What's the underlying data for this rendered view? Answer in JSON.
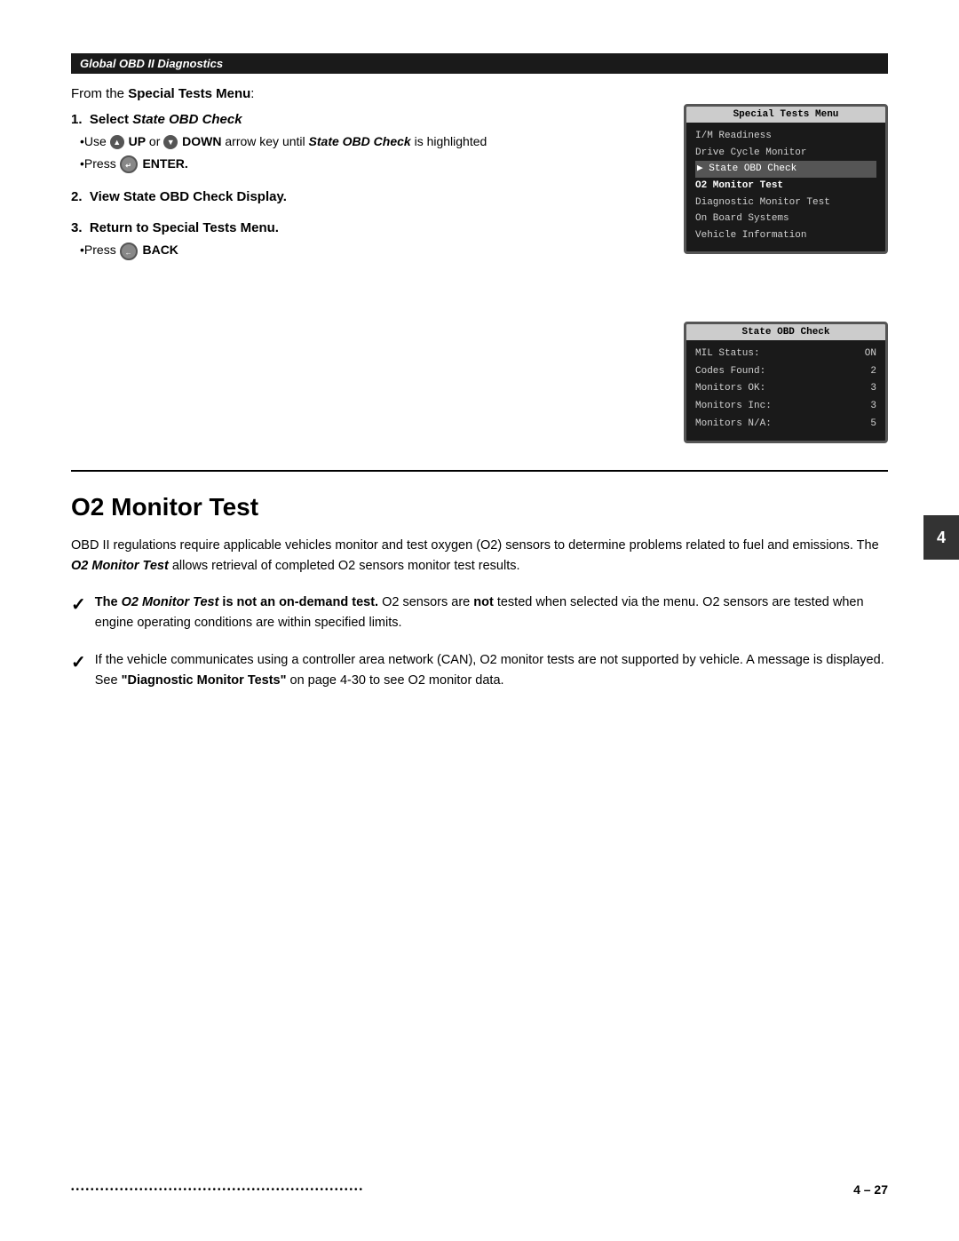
{
  "header": {
    "title": "Global OBD II Diagnostics"
  },
  "intro": {
    "from_text": "From the ",
    "from_bold": "Special Tests Menu",
    "from_colon": ":"
  },
  "steps": [
    {
      "number": "1.",
      "title_prefix": "Select ",
      "title_bold": "State OBD Check",
      "bullets": [
        {
          "prefix": "•Use ",
          "up_icon": "▲",
          "up_label": "UP",
          "mid": " or ",
          "down_icon": "▼",
          "down_label": "DOWN",
          "suffix": " arrow key until ",
          "italic": "State OBD Check",
          "end": " is highlighted"
        },
        {
          "prefix": "•Press ",
          "icon_label": "↵",
          "label": "ENTER."
        }
      ]
    },
    {
      "number": "2.",
      "title": "View State OBD Check Display."
    },
    {
      "number": "3.",
      "title_prefix": "Return to Special Tests",
      "title_end": " Menu.",
      "bullets": [
        {
          "prefix": "•Press ",
          "icon_label": "←",
          "label": "BACK"
        }
      ]
    }
  ],
  "screen1": {
    "title": "Special Tests Menu",
    "items": [
      {
        "label": "I/M Readiness",
        "highlighted": false
      },
      {
        "label": "Drive Cycle Monitor",
        "highlighted": false
      },
      {
        "label": "State OBD Check",
        "highlighted": true
      },
      {
        "label": "O2 Monitor Test",
        "bold": true
      },
      {
        "label": "Diagnostic Monitor Test",
        "highlighted": false
      },
      {
        "label": "On Board Systems",
        "highlighted": false
      },
      {
        "label": "Vehicle Information",
        "highlighted": false
      }
    ]
  },
  "screen2": {
    "title": "State OBD Check",
    "rows": [
      {
        "label": "MIL Status:",
        "value": "ON"
      },
      {
        "label": "Codes Found:",
        "value": "2"
      },
      {
        "label": "Monitors OK:",
        "value": "3"
      },
      {
        "label": "Monitors Inc:",
        "value": "3"
      },
      {
        "label": "Monitors N/A:",
        "value": "5"
      }
    ]
  },
  "page_tab": "4",
  "section_heading": "O2 Monitor Test",
  "body_paragraph": "OBD II regulations require applicable vehicles monitor and test oxygen (O2) sensors to determine problems related to fuel and emissions. The ",
  "body_bold": "O2 Monitor Test",
  "body_suffix": " allows retrieval of completed O2 sensors monitor test results.",
  "check_items": [
    {
      "bold_prefix": "The ",
      "bold_italic": "O2 Monitor Test",
      "bold_mid": " is not an on-demand test.",
      "text": " O2 sensors are ",
      "bold_not": "not",
      "text2": " tested when selected via the menu. O2 sensors are tested when engine operating conditions are within specified limits."
    },
    {
      "text": "If the vehicle communicates using a controller area network (CAN), O2 monitor tests are not supported by vehicle. A message is displayed. See ",
      "quote_bold": "\"Diagnostic Monitor Tests\"",
      "text2": " on page 4-30 to see O2 monitor data."
    }
  ],
  "footer": {
    "dots": "••••••••••••••••••••••••••••••••••••••••••••••••••••••••••••",
    "page": "4 – 27"
  }
}
